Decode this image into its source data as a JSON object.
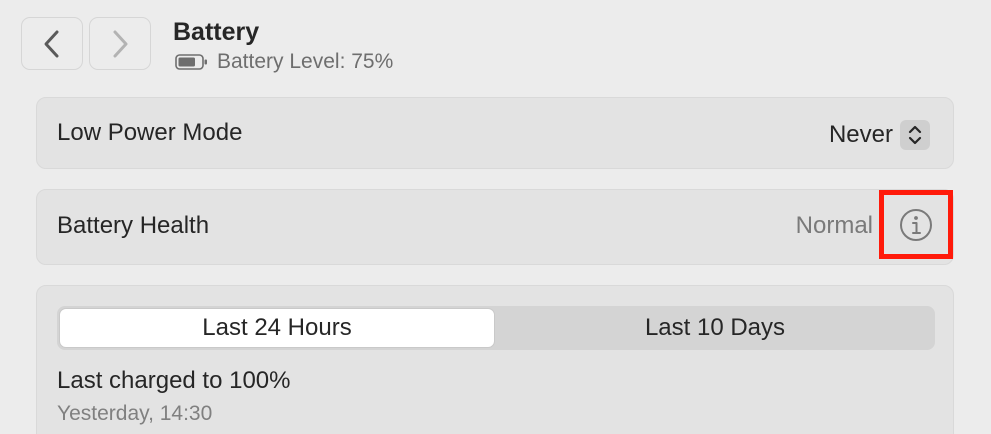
{
  "header": {
    "title": "Battery",
    "subtitle": "Battery Level: 75%",
    "battery_icon": "battery-icon",
    "back_icon": "chevron-left-icon",
    "forward_icon": "chevron-right-icon"
  },
  "low_power_mode": {
    "label": "Low Power Mode",
    "value": "Never",
    "icon": "up-down-chevron-icon"
  },
  "battery_health": {
    "label": "Battery Health",
    "value": "Normal",
    "icon": "info-icon",
    "highlight_color": "#ff1a0a"
  },
  "usage": {
    "tabs": [
      {
        "label": "Last 24 Hours",
        "selected": true
      },
      {
        "label": "Last 10 Days",
        "selected": false
      }
    ],
    "last_charged_title": "Last charged to 100%",
    "last_charged_time": "Yesterday, 14:30"
  },
  "battery_level_fraction": 0.75
}
